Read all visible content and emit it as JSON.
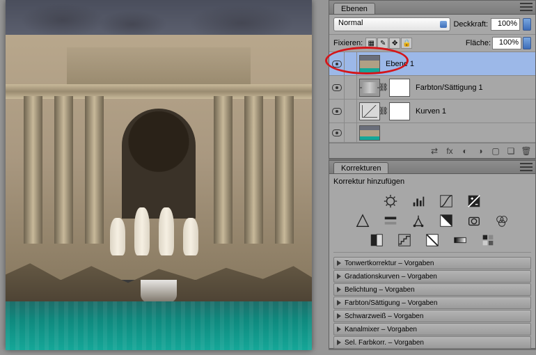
{
  "layers_panel": {
    "title": "Ebenen",
    "blend_mode": "Normal",
    "opacity_label": "Deckkraft:",
    "opacity_value": "100%",
    "lock_label": "Fixieren:",
    "fill_label": "Fläche:",
    "fill_value": "100%",
    "layers": [
      {
        "name": "Ebene 1",
        "selected": true,
        "type": "image"
      },
      {
        "name": "Farbton/Sättigung 1",
        "selected": false,
        "type": "huesat"
      },
      {
        "name": "Kurven 1",
        "selected": false,
        "type": "curves"
      }
    ]
  },
  "adjustments_panel": {
    "title": "Korrekturen",
    "subtitle": "Korrektur hinzufügen",
    "row1_icons": [
      "brightness-contrast-icon",
      "levels-icon",
      "curves-icon",
      "exposure-icon"
    ],
    "row2_icons": [
      "vibrance-icon",
      "hue-saturation-icon",
      "color-balance-icon",
      "black-white-icon",
      "photo-filter-icon",
      "channel-mixer-icon"
    ],
    "row3_icons": [
      "invert-icon",
      "posterize-icon",
      "threshold-icon",
      "gradient-map-icon",
      "selective-color-icon"
    ],
    "presets": [
      "Tonwertkorrektur – Vorgaben",
      "Gradationskurven – Vorgaben",
      "Belichtung – Vorgaben",
      "Farbton/Sättigung – Vorgaben",
      "Schwarzweiß – Vorgaben",
      "Kanalmixer – Vorgaben",
      "Sel. Farbkorr. – Vorgaben"
    ]
  },
  "footer_icons": [
    "link-icon",
    "fx-icon",
    "mask-icon",
    "adjustment-icon",
    "group-icon",
    "new-layer-icon",
    "trash-icon"
  ],
  "chart_data": null
}
